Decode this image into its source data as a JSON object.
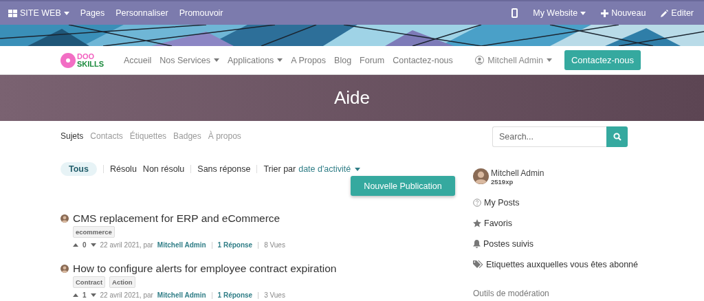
{
  "topbar": {
    "left": [
      {
        "label": "SITE WEB",
        "kind": "apps"
      },
      {
        "label": "Pages",
        "kind": "plain"
      },
      {
        "label": "Personnaliser",
        "kind": "plain"
      },
      {
        "label": "Promouvoir",
        "kind": "plain"
      }
    ],
    "right": [
      {
        "kind": "mobile"
      },
      {
        "label": "My Website",
        "kind": "dropdown"
      },
      {
        "label": "Nouveau",
        "kind": "plus"
      },
      {
        "label": "Editer",
        "kind": "pencil"
      }
    ]
  },
  "navbar": {
    "logo": {
      "top": "DOO",
      "bottom": "SKILLS"
    },
    "links": [
      {
        "label": "Accueil",
        "dropdown": false
      },
      {
        "label": "Nos Services",
        "dropdown": true
      },
      {
        "label": "Applications",
        "dropdown": true
      },
      {
        "label": "A Propos",
        "dropdown": false
      },
      {
        "label": "Blog",
        "dropdown": false
      },
      {
        "label": "Forum",
        "dropdown": false
      },
      {
        "label": "Contactez-nous",
        "dropdown": false
      }
    ],
    "user": "Mitchell Admin",
    "cta": "Contactez-nous"
  },
  "header": {
    "title": "Aide"
  },
  "subnav": {
    "tabs": [
      {
        "label": "Sujets",
        "selected": true
      },
      {
        "label": "Contacts",
        "selected": false
      },
      {
        "label": "Étiquettes",
        "selected": false
      },
      {
        "label": "Badges",
        "selected": false
      },
      {
        "label": "À propos",
        "selected": false
      }
    ],
    "search": {
      "placeholder": "Search..."
    }
  },
  "filters": {
    "groups": [
      [
        {
          "label": "Tous",
          "selected": true
        }
      ],
      [
        {
          "label": "Résolu",
          "selected": false
        },
        {
          "label": "Non résolu",
          "selected": false
        }
      ],
      [
        {
          "label": "Sans réponse",
          "selected": false
        }
      ]
    ],
    "sort_label": "Trier par",
    "sort_value": "date d'activité"
  },
  "new_post_button": "Nouvelle Publication",
  "posts": [
    {
      "title": "CMS replacement for ERP and eCommerce",
      "tags": [
        "ecommerce"
      ],
      "votes": "0",
      "date": "22 avril 2021, par",
      "author": "Mitchell Admin",
      "answers": "1 Réponse",
      "views": "8 Vues"
    },
    {
      "title": "How to configure alerts for employee contract expiration",
      "tags": [
        "Contract",
        "Action"
      ],
      "votes": "1",
      "date": "22 avril 2021, par",
      "author": "Mitchell Admin",
      "answers": "1 Réponse",
      "views": "3 Vues"
    }
  ],
  "sidebar": {
    "user": {
      "name": "Mitchell Admin",
      "xp": "2519xp"
    },
    "links": [
      {
        "label": "My Posts",
        "kind": "question"
      },
      {
        "label": "Favoris",
        "kind": "star"
      },
      {
        "label": "Postes suivis",
        "kind": "bell"
      },
      {
        "label": "Etiquettes auxquelles vous êtes abonné",
        "kind": "tags"
      }
    ],
    "section": "Outils de modération"
  }
}
